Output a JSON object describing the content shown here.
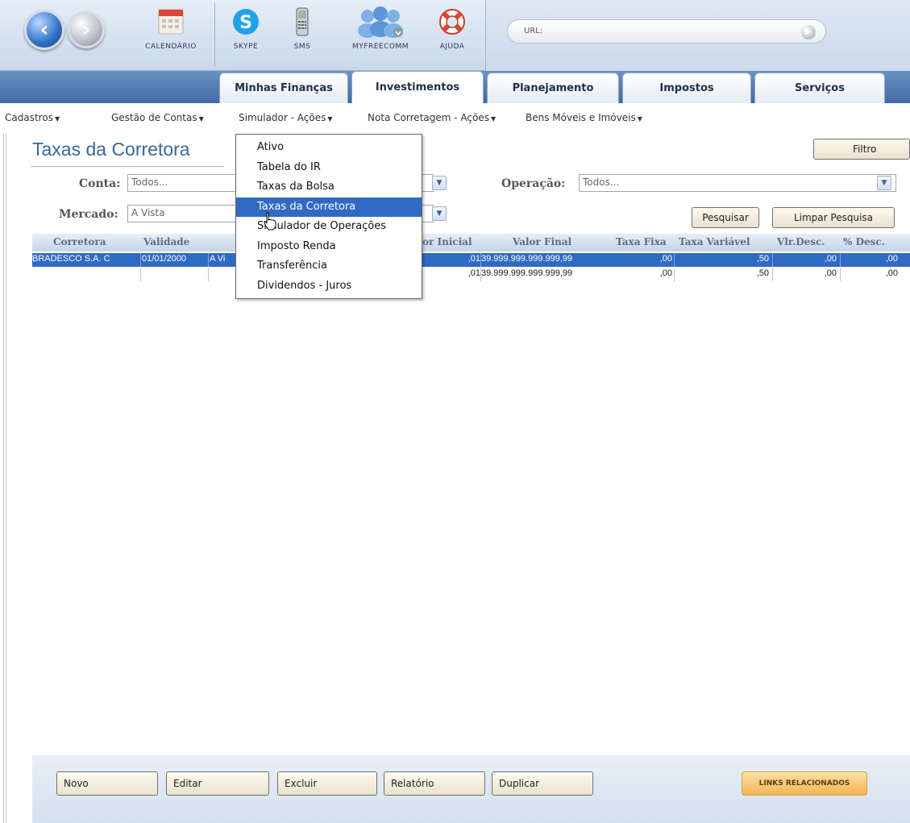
{
  "toolbar": {
    "tools": [
      {
        "icon": "calendar-icon",
        "label": "CALENDÁRIO"
      },
      {
        "icon": "skype-icon",
        "label": "SKYPE"
      },
      {
        "icon": "phone-icon",
        "label": "SMS"
      },
      {
        "icon": "people-icon",
        "label": "MYFREECOMM"
      },
      {
        "icon": "lifebuoy-icon",
        "label": "AJUDA"
      }
    ],
    "url_label": "URL:"
  },
  "tabs": [
    "Minhas Finanças",
    "Investimentos",
    "Planejamento",
    "Impostos",
    "Serviços"
  ],
  "active_tab": "Investimentos",
  "menus": [
    "Cadastros",
    "Gestão de Contas",
    "Simulador - Ações",
    "Nota Corretagem - Ações",
    "Bens Móveis e Imóveis"
  ],
  "page": {
    "title": "Taxas da Corretora",
    "filter_label": "Filtro",
    "conta_label": "Conta:",
    "conta_value": "Todos...",
    "mercado_label": "Mercado:",
    "mercado_value": "A Vista",
    "operacao_label": "Operação:",
    "operacao_value": "Todos...",
    "search_label": "Pesquisar",
    "clear_label": "Limpar Pesquisa"
  },
  "table": {
    "columns": [
      "Corretora",
      "Validade",
      "",
      "or Inicial",
      "Valor Final",
      "Taxa Fixa",
      "Taxa Variável",
      "Vlr.Desc.",
      "% Desc."
    ],
    "rows": [
      [
        "BRADESCO S.A. C",
        "01/01/2000",
        "A Vi",
        ",01",
        "39.999.999.999.999,99",
        ",00",
        ",50",
        ",00",
        ",00"
      ],
      [
        "",
        "",
        "",
        ",01",
        "39.999.999.999.999,99",
        ",00",
        ",50",
        ",00",
        ",00"
      ]
    ]
  },
  "dropdown": {
    "items": [
      "Ativo",
      "Tabela do IR",
      "Taxas da Bolsa",
      "Taxas da Corretora",
      "Simulador de Operações",
      "Imposto Renda",
      "Transferência",
      "Dividendos - Juros"
    ],
    "highlighted": "Taxas da Corretora"
  },
  "footer": {
    "buttons": [
      "Novo",
      "Editar",
      "Excluir",
      "Relatório",
      "Duplicar"
    ],
    "links_label": "LINKS RELACIONADOS"
  },
  "colors": {
    "accent": "#316ac5",
    "title": "#3c6796",
    "tabbar": "#4f79b0"
  }
}
